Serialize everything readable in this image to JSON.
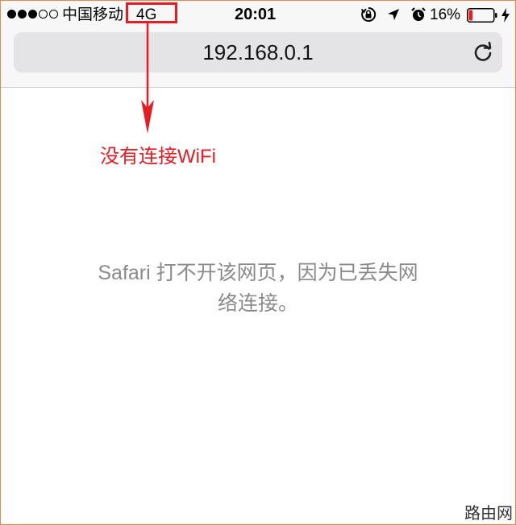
{
  "status_bar": {
    "carrier": "中国移动",
    "network": "4G",
    "time": "20:01",
    "battery_percent": "16%",
    "battery_level": 0.16
  },
  "address_bar": {
    "url": "192.168.0.1"
  },
  "annotation": {
    "text": "没有连接WiFi",
    "color": "#e51c23"
  },
  "error": {
    "line1": "Safari 打不开该网页，因为已丢失网",
    "line2": "络连接。"
  },
  "watermark": "路由网"
}
